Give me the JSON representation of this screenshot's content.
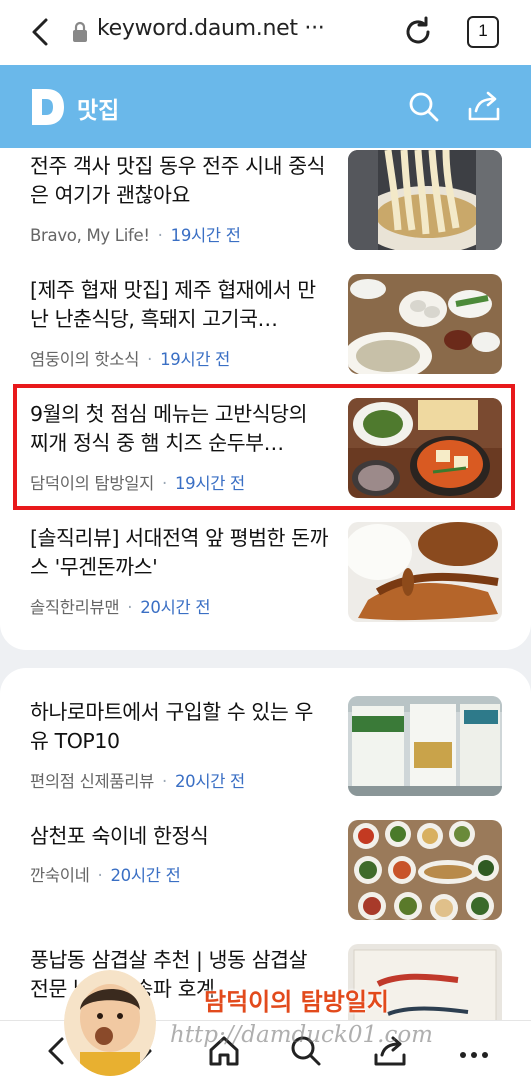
{
  "browser": {
    "url": "keyword.daum.net ···",
    "tab_count": "1"
  },
  "header": {
    "title": "맛집"
  },
  "articles": [
    {
      "headline": "전주 객사 맛집 동우 전주 시내 중식은 여기가 괜찮아요",
      "source": "Bravo, My Life!",
      "time": "19시간 전"
    },
    {
      "headline": "[제주 협재 맛집] 제주 협재에서 만난 난춘식당, 흑돼지 고기국…",
      "source": "염둥이의 핫소식",
      "time": "19시간 전"
    },
    {
      "headline": "9월의 첫 점심 메뉴는 고반식당의 찌개 정식 중 햄 치즈 순두부…",
      "source": "담덕이의 탐방일지",
      "time": "19시간 전"
    },
    {
      "headline": "[솔직리뷰] 서대전역 앞 평범한 돈까스 '무겐돈까스'",
      "source": "솔직한리뷰맨",
      "time": "20시간 전"
    },
    {
      "headline": "하나로마트에서 구입할 수 있는 우유 TOP10",
      "source": "편의점 신제품리뷰",
      "time": "20시간 전"
    },
    {
      "headline": "삼천포 숙이네 한정식",
      "source": "깐숙이네",
      "time": "20시간 전"
    },
    {
      "headline": "풍납동 삼겹살 추천 | 냉동 삼겹살 전문 남회관 송파 호계",
      "source": "",
      "time": ""
    }
  ],
  "watermark": {
    "text": "담덕이의 탐방일지",
    "url": "http://damduck01.com"
  },
  "colors": {
    "header_bg": "#6ab8ea",
    "highlight": "#e8191b",
    "time_text": "#3a6fc4"
  },
  "icons": [
    "back-icon",
    "lock-icon",
    "reload-icon",
    "tabs-icon",
    "daum-logo",
    "search-icon",
    "share-icon",
    "home-icon",
    "more-icon"
  ]
}
